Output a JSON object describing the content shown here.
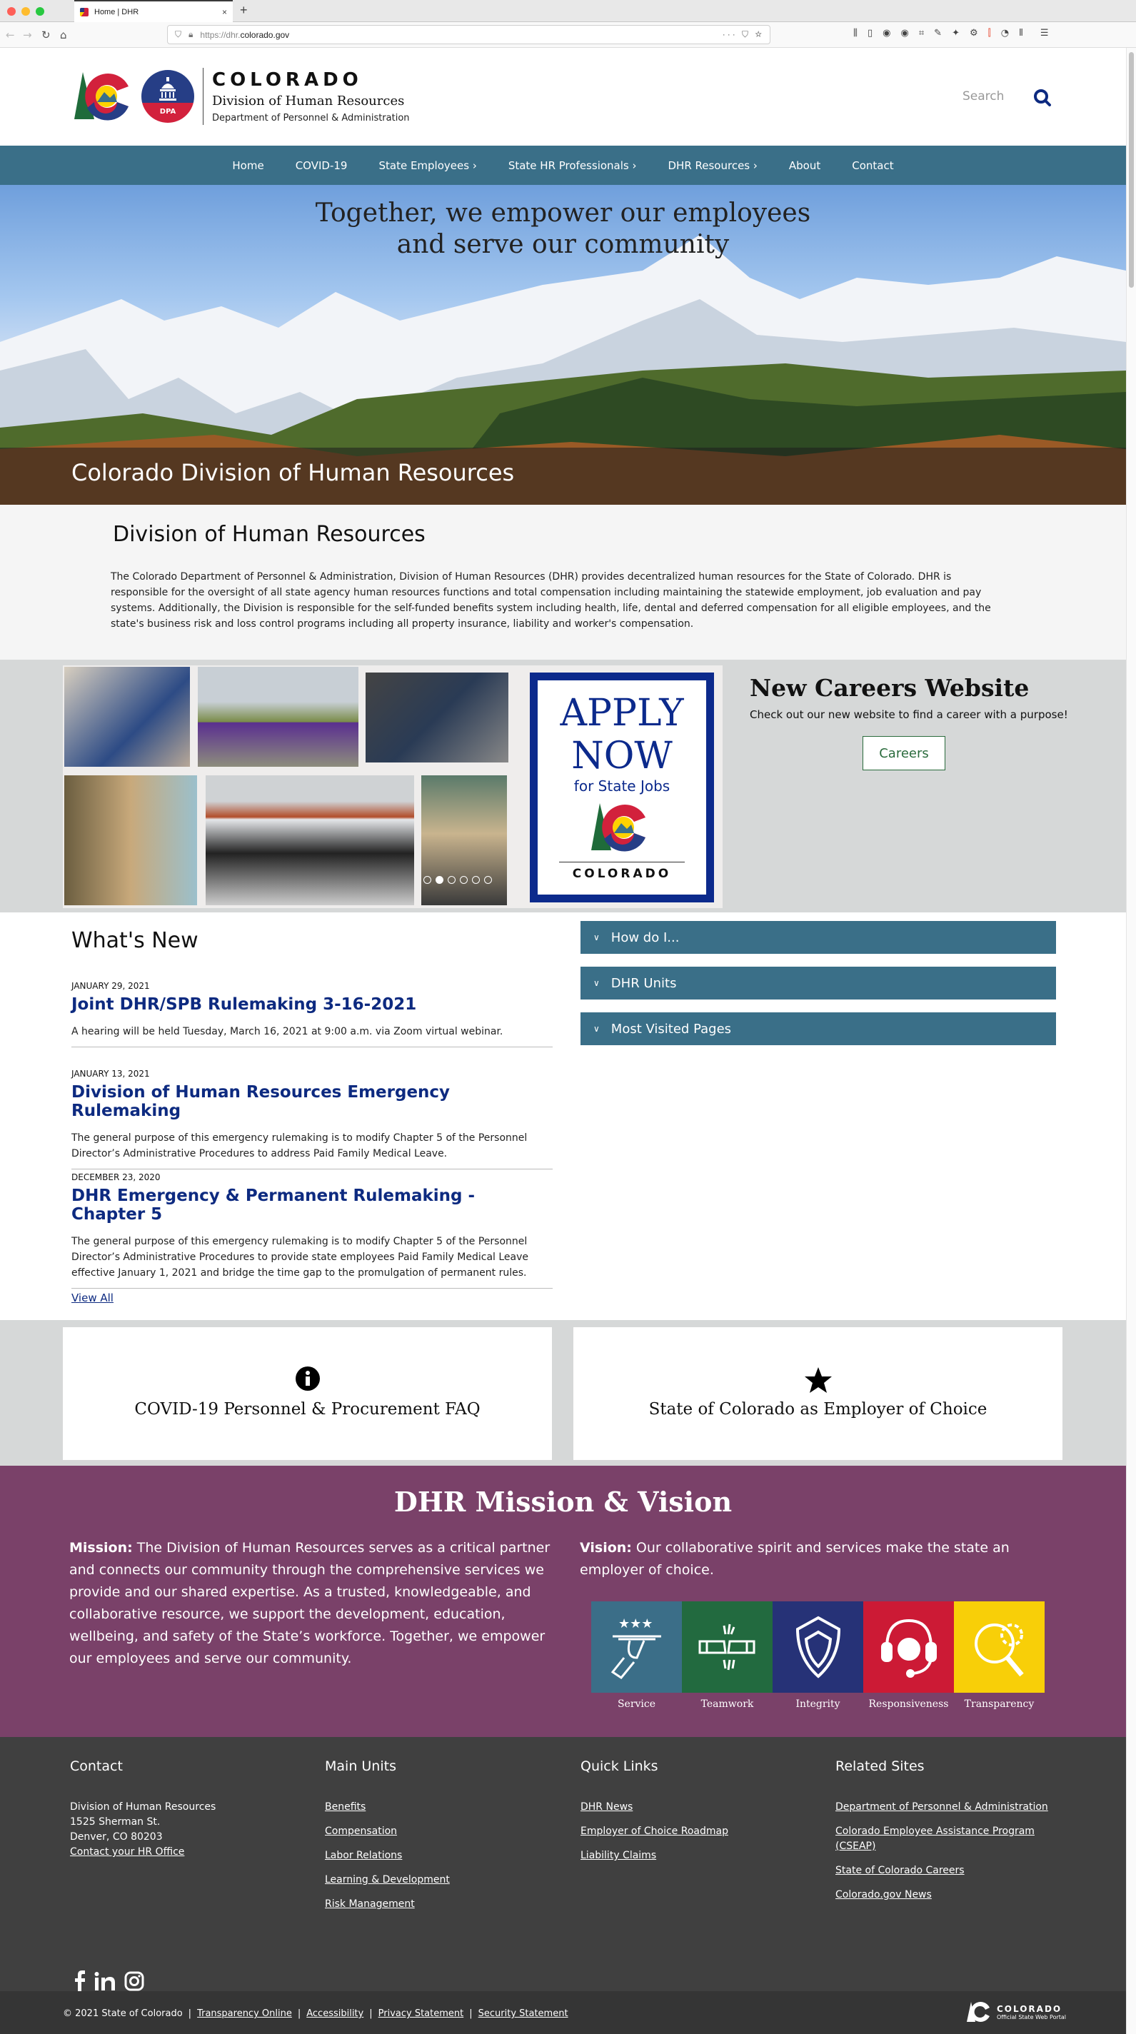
{
  "browser": {
    "tab_title": "Home | DHR",
    "url_prefix": "https://dhr.",
    "url_host": "colorado.gov",
    "new_tab": "+",
    "close_tab": "×"
  },
  "header": {
    "brand_state": "COLORADO",
    "brand_division": "Division of Human Resources",
    "brand_department": "Department of Personnel & Administration",
    "dpa_label": "DPA",
    "search_placeholder": "Search"
  },
  "nav": {
    "items": [
      {
        "label": "Home"
      },
      {
        "label": "COVID-19"
      },
      {
        "label": "State Employees ›"
      },
      {
        "label": "State HR Professionals ›"
      },
      {
        "label": "DHR Resources ›"
      },
      {
        "label": "About"
      },
      {
        "label": "Contact"
      }
    ]
  },
  "hero": {
    "tagline_line1": "Together, we empower our employees",
    "tagline_line2": "and serve our community",
    "caption": "Colorado Division of Human Resources"
  },
  "intro": {
    "title": "Division of Human Resources",
    "body": "The Colorado Department of Personnel & Administration, Division of Human Resources (DHR) provides decentralized human resources for the State of Colorado. DHR is responsible for the oversight of all state agency human resources functions and total compensation including maintaining the statewide employment, job evaluation and pay systems. Additionally, the Division is responsible for the self-funded benefits system including health, life, dental and deferred compensation for all eligible employees, and the state's business risk and loss control programs including all property insurance, liability and worker's compensation."
  },
  "carousel": {
    "slide_count": 6,
    "active_slide": 2
  },
  "apply_banner": {
    "line1": "APPLY",
    "line2": "NOW",
    "line3": "for State Jobs",
    "line4": "COLORADO"
  },
  "careers": {
    "title": "New Careers Website",
    "text": "Check out our new website to find a career with a purpose!",
    "button": "Careers"
  },
  "whats_new": {
    "title": "What's New",
    "items": [
      {
        "date": "JANUARY 29, 2021",
        "title": "Joint DHR/SPB Rulemaking 3-16-2021",
        "desc": "A hearing will be held Tuesday, March 16, 2021 at 9:00 a.m. via Zoom virtual webinar."
      },
      {
        "date": "JANUARY 13, 2021",
        "title": "Division of Human Resources Emergency Rulemaking",
        "desc": "The general purpose of this emergency rulemaking is to modify Chapter 5 of the Personnel Director’s Administrative Procedures to address Paid Family Medical Leave."
      },
      {
        "date": "DECEMBER 23, 2020",
        "title": "DHR Emergency & Permanent Rulemaking - Chapter 5",
        "desc": "The general purpose of this emergency rulemaking is to modify Chapter 5 of the Personnel Director’s Administrative Procedures to provide state employees Paid Family Medical Leave effective January 1, 2021 and bridge the time gap to the promulgation of permanent rules."
      }
    ],
    "view_all": "View All"
  },
  "accordions": [
    {
      "label": "How do I..."
    },
    {
      "label": "DHR Units"
    },
    {
      "label": "Most Visited Pages"
    }
  ],
  "cards": [
    {
      "icon": "info-icon",
      "label": "COVID-19 Personnel & Procurement FAQ"
    },
    {
      "icon": "star-icon",
      "label": "State of Colorado as Employer of Choice"
    }
  ],
  "mission": {
    "title": "DHR Mission & Vision",
    "mission_label": "Mission:",
    "mission_text": " The Division of Human Resources serves as a critical partner and connects our community through the comprehensive services we provide and our shared expertise. As a trusted, knowledgeable, and collaborative resource, we support the development, education, wellbeing, and safety of the State’s workforce. Together, we empower our employees and serve our community.",
    "vision_label": "Vision:",
    "vision_text": " Our collaborative spirit and services make the state an employer of choice.",
    "values": [
      {
        "label": "Service",
        "color": "#3b6e88",
        "icon": "serving-tray-icon"
      },
      {
        "label": "Teamwork",
        "color": "#226a3f",
        "icon": "fist-bump-icon"
      },
      {
        "label": "Integrity",
        "color": "#263277",
        "icon": "shield-icon"
      },
      {
        "label": "Responsiveness",
        "color": "#cc1a35",
        "icon": "headset-icon"
      },
      {
        "label": "Transparency",
        "color": "#f8cf08",
        "icon": "magnifier-gear-icon"
      }
    ]
  },
  "footer": {
    "contact": {
      "title": "Contact",
      "lines": [
        "Division of Human Resources",
        "1525 Sherman St.",
        "Denver, CO 80203"
      ],
      "link": "Contact your HR Office"
    },
    "main_units": {
      "title": "Main Units",
      "links": [
        "Benefits",
        "Compensation",
        "Labor Relations",
        "Learning & Development",
        "Risk Management"
      ]
    },
    "quick_links": {
      "title": "Quick Links",
      "links": [
        "DHR News",
        "Employer of Choice Roadmap",
        "Liability Claims"
      ]
    },
    "related_sites": {
      "title": "Related Sites",
      "links": [
        "Department of Personnel & Administration",
        "Colorado Employee Assistance Program (CSEAP)",
        "State of Colorado Careers",
        "Colorado.gov News"
      ]
    },
    "copyright": "© 2021 State of Colorado",
    "legal_links": [
      "Transparency Online",
      "Accessibility",
      "Privacy Statement",
      "Security Statement"
    ],
    "portal_title": "COLORADO",
    "portal_subtitle": "Official State Web Portal"
  },
  "colors": {
    "nav_bg": "#3a6f88",
    "link_blue": "#0d2a80",
    "mission_bg": "#7a4169",
    "footer_bg": "#404040"
  }
}
